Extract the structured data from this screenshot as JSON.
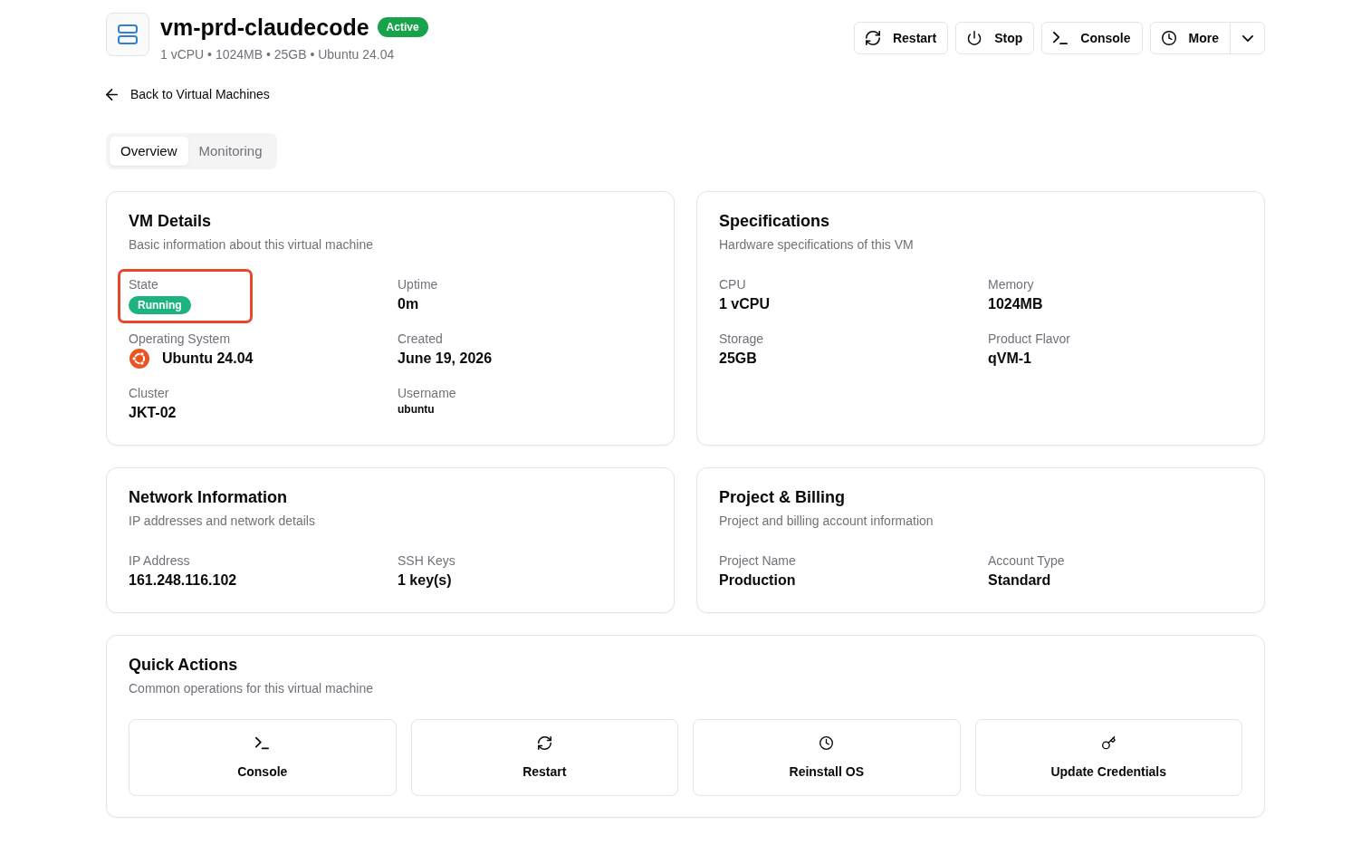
{
  "header": {
    "title": "vm-prd-claudecode",
    "badge": "Active",
    "subtitle": "1 vCPU • 1024MB • 25GB • Ubuntu 24.04"
  },
  "actions": [
    {
      "label": "Restart",
      "kind": "button"
    },
    {
      "label": "Stop",
      "kind": "button"
    },
    {
      "label": "Console",
      "kind": "button"
    },
    {
      "label": "More",
      "kind": "split"
    }
  ],
  "back_link": "Back to Virtual Machines",
  "tabs": [
    {
      "label": "Overview",
      "selected": true
    },
    {
      "label": "Monitoring",
      "selected": false
    }
  ],
  "cards": [
    {
      "title": "VM Details",
      "description": "Basic information about this virtual machine",
      "fields": [
        {
          "label": "State",
          "value": "Running",
          "kind": "badge",
          "highlighted": true
        },
        {
          "label": "Uptime",
          "value": "0m",
          "kind": "text",
          "highlighted": false
        },
        {
          "label": "Operating System",
          "value": "Ubuntu 24.04",
          "kind": "os",
          "highlighted": false
        },
        {
          "label": "Created",
          "value": "June 19, 2026",
          "kind": "text",
          "highlighted": false
        },
        {
          "label": "Cluster",
          "value": "JKT-02",
          "kind": "text",
          "highlighted": false
        },
        {
          "label": "Username",
          "value": "ubuntu",
          "kind": "small",
          "highlighted": false
        }
      ]
    },
    {
      "title": "Specifications",
      "description": "Hardware specifications of this VM",
      "fields": [
        {
          "label": "CPU",
          "value": "1 vCPU",
          "kind": "text",
          "highlighted": false
        },
        {
          "label": "Memory",
          "value": "1024MB",
          "kind": "text",
          "highlighted": false
        },
        {
          "label": "Storage",
          "value": "25GB",
          "kind": "text",
          "highlighted": false
        },
        {
          "label": "Product Flavor",
          "value": "qVM-1",
          "kind": "text",
          "highlighted": false
        }
      ]
    },
    {
      "title": "Network Information",
      "description": "IP addresses and network details",
      "fields": [
        {
          "label": "IP Address",
          "value": "161.248.116.102",
          "kind": "text",
          "highlighted": false
        },
        {
          "label": "SSH Keys",
          "value": "1 key(s)",
          "kind": "text",
          "highlighted": false
        }
      ]
    },
    {
      "title": "Project & Billing",
      "description": "Project and billing account information",
      "fields": [
        {
          "label": "Project Name",
          "value": "Production",
          "kind": "text",
          "highlighted": false
        },
        {
          "label": "Account Type",
          "value": "Standard",
          "kind": "text",
          "highlighted": false
        }
      ]
    }
  ],
  "quick_actions": {
    "title": "Quick Actions",
    "description": "Common operations for this virtual machine",
    "items": [
      {
        "label": "Console"
      },
      {
        "label": "Restart"
      },
      {
        "label": "Reinstall OS"
      },
      {
        "label": "Update Credentials"
      }
    ]
  }
}
